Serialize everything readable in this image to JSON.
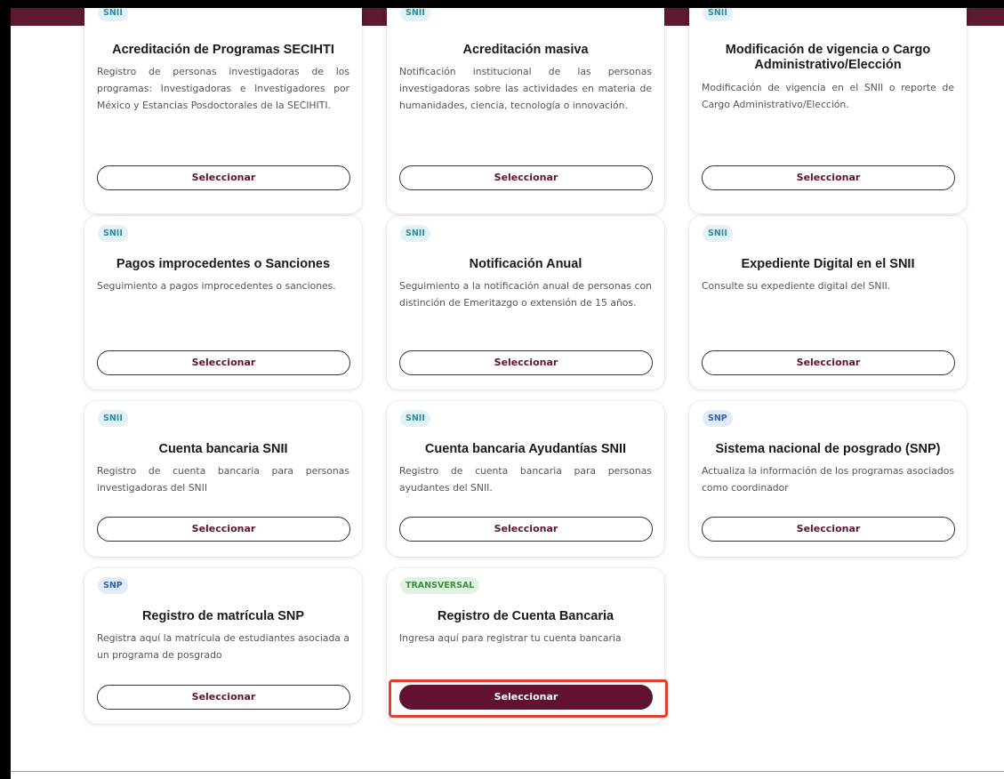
{
  "select_label": "Seleccionar",
  "accent_color": "#611232",
  "highlight_color": "#e0402e",
  "cards": [
    {
      "badge": "SNII",
      "title": "Acreditación de Programas SECIHTI",
      "description": "Registro de personas investigadoras de los programas: Investigadoras e Investigadores por México y Estancias Posdoctorales de la SECIHITI."
    },
    {
      "badge": "SNII",
      "title": "Acreditación masiva",
      "description": "Notificación institucional de las personas investigadoras sobre las actividades en materia de humanidades, ciencia, tecnología o innovación."
    },
    {
      "badge": "SNII",
      "title": "Modificación de vigencia o Cargo Administrativo/Elección",
      "description": "Modificación de vigencia en el SNII o reporte de Cargo Administrativo/Elección."
    },
    {
      "badge": "SNII",
      "title": "Pagos improcedentes o Sanciones",
      "description": "Seguimiento a pagos improcedentes o sanciones."
    },
    {
      "badge": "SNII",
      "title": "Notificación Anual",
      "description": "Seguimiento a la notificación anual de personas con distinción de Emeritazgo o extensión de 15 años."
    },
    {
      "badge": "SNII",
      "title": "Expediente Digital en el SNII",
      "description": "Consulte su expediente digital del SNII."
    },
    {
      "badge": "SNII",
      "title": "Cuenta bancaria SNII",
      "description": "Registro de cuenta bancaria para personas investigadoras del SNII"
    },
    {
      "badge": "SNII",
      "title": "Cuenta bancaria Ayudantías SNII",
      "description": "Registro de cuenta bancaria para personas ayudantes del SNII."
    },
    {
      "badge": "SNP",
      "title": "Sistema nacional de posgrado (SNP)",
      "description": "Actualiza la información de los programas asociados como coordinador"
    },
    {
      "badge": "SNP",
      "title": "Registro de matrícula SNP",
      "description": "Registra aquí la matrícula de estudiantes asociada a un programa de posgrado"
    },
    {
      "badge": "TRANSVERSAL",
      "title": "Registro de Cuenta Bancaria",
      "description": "Ingresa aquí para registrar tu cuenta bancaria"
    }
  ]
}
